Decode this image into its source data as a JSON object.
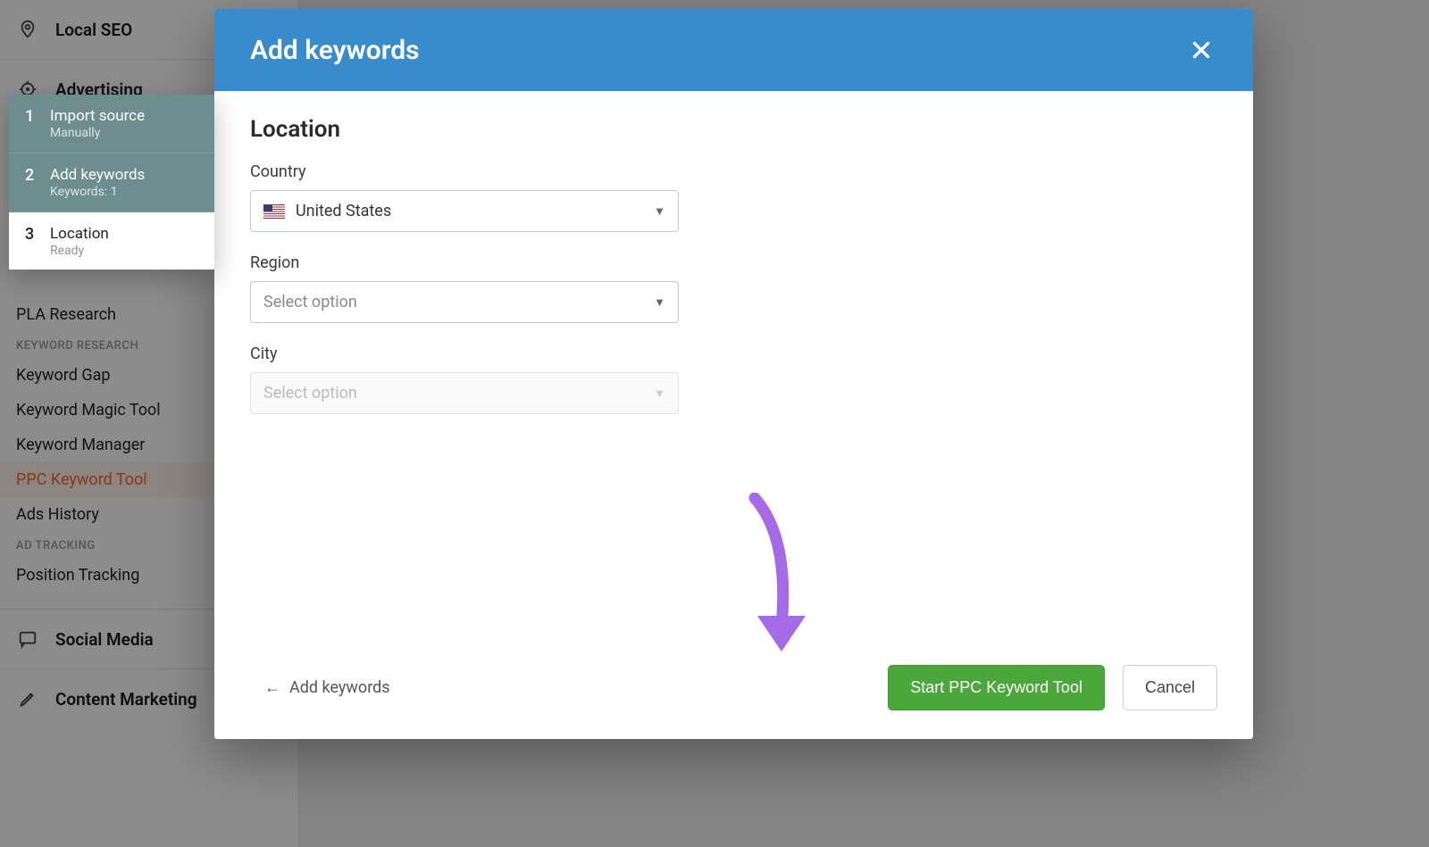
{
  "sidebar": {
    "categories": [
      {
        "label": "Local SEO"
      },
      {
        "label": "Advertising"
      },
      {
        "label": "Social Media"
      },
      {
        "label": "Content Marketing"
      }
    ],
    "pla_research": "PLA Research",
    "groups": [
      {
        "heading": "KEYWORD RESEARCH",
        "items": [
          "Keyword Gap",
          "Keyword Magic Tool",
          "Keyword Manager",
          "PPC Keyword Tool",
          "Ads History"
        ],
        "active_index": 3
      },
      {
        "heading": "AD TRACKING",
        "items": [
          "Position Tracking"
        ]
      }
    ]
  },
  "wizard_steps": [
    {
      "num": "1",
      "title": "Import source",
      "sub": "Manually",
      "state": "done"
    },
    {
      "num": "2",
      "title": "Add keywords",
      "sub": "Keywords: 1",
      "state": "done"
    },
    {
      "num": "3",
      "title": "Location",
      "sub": "Ready",
      "state": "current"
    }
  ],
  "modal": {
    "title": "Add keywords",
    "section": "Location",
    "fields": {
      "country_label": "Country",
      "country_value": "United States",
      "region_label": "Region",
      "region_placeholder": "Select option",
      "city_label": "City",
      "city_placeholder": "Select option"
    },
    "back_label": "Add keywords",
    "primary_button": "Start PPC Keyword Tool",
    "cancel_button": "Cancel"
  }
}
